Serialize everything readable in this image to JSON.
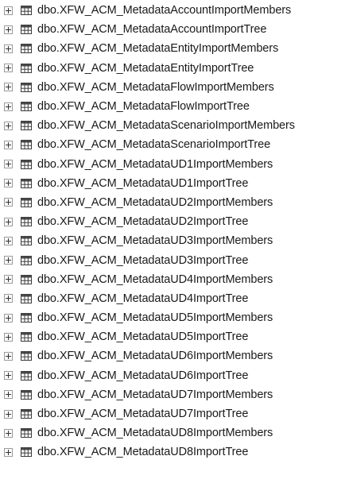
{
  "tree": {
    "items": [
      {
        "label": "dbo.XFW_ACM_MetadataAccountImportMembers"
      },
      {
        "label": "dbo.XFW_ACM_MetadataAccountImportTree"
      },
      {
        "label": "dbo.XFW_ACM_MetadataEntityImportMembers"
      },
      {
        "label": "dbo.XFW_ACM_MetadataEntityImportTree"
      },
      {
        "label": "dbo.XFW_ACM_MetadataFlowImportMembers"
      },
      {
        "label": "dbo.XFW_ACM_MetadataFlowImportTree"
      },
      {
        "label": "dbo.XFW_ACM_MetadataScenarioImportMembers"
      },
      {
        "label": "dbo.XFW_ACM_MetadataScenarioImportTree"
      },
      {
        "label": "dbo.XFW_ACM_MetadataUD1ImportMembers"
      },
      {
        "label": "dbo.XFW_ACM_MetadataUD1ImportTree"
      },
      {
        "label": "dbo.XFW_ACM_MetadataUD2ImportMembers"
      },
      {
        "label": "dbo.XFW_ACM_MetadataUD2ImportTree"
      },
      {
        "label": "dbo.XFW_ACM_MetadataUD3ImportMembers"
      },
      {
        "label": "dbo.XFW_ACM_MetadataUD3ImportTree"
      },
      {
        "label": "dbo.XFW_ACM_MetadataUD4ImportMembers"
      },
      {
        "label": "dbo.XFW_ACM_MetadataUD4ImportTree"
      },
      {
        "label": "dbo.XFW_ACM_MetadataUD5ImportMembers"
      },
      {
        "label": "dbo.XFW_ACM_MetadataUD5ImportTree"
      },
      {
        "label": "dbo.XFW_ACM_MetadataUD6ImportMembers"
      },
      {
        "label": "dbo.XFW_ACM_MetadataUD6ImportTree"
      },
      {
        "label": "dbo.XFW_ACM_MetadataUD7ImportMembers"
      },
      {
        "label": "dbo.XFW_ACM_MetadataUD7ImportTree"
      },
      {
        "label": "dbo.XFW_ACM_MetadataUD8ImportMembers"
      },
      {
        "label": "dbo.XFW_ACM_MetadataUD8ImportTree"
      }
    ]
  },
  "icons": {
    "expander": "expand-plus-icon",
    "node": "table-icon"
  },
  "colors": {
    "table_icon_border": "#3b3b3b",
    "table_icon_header": "#4a4a4a",
    "text": "#1a1a1a"
  }
}
